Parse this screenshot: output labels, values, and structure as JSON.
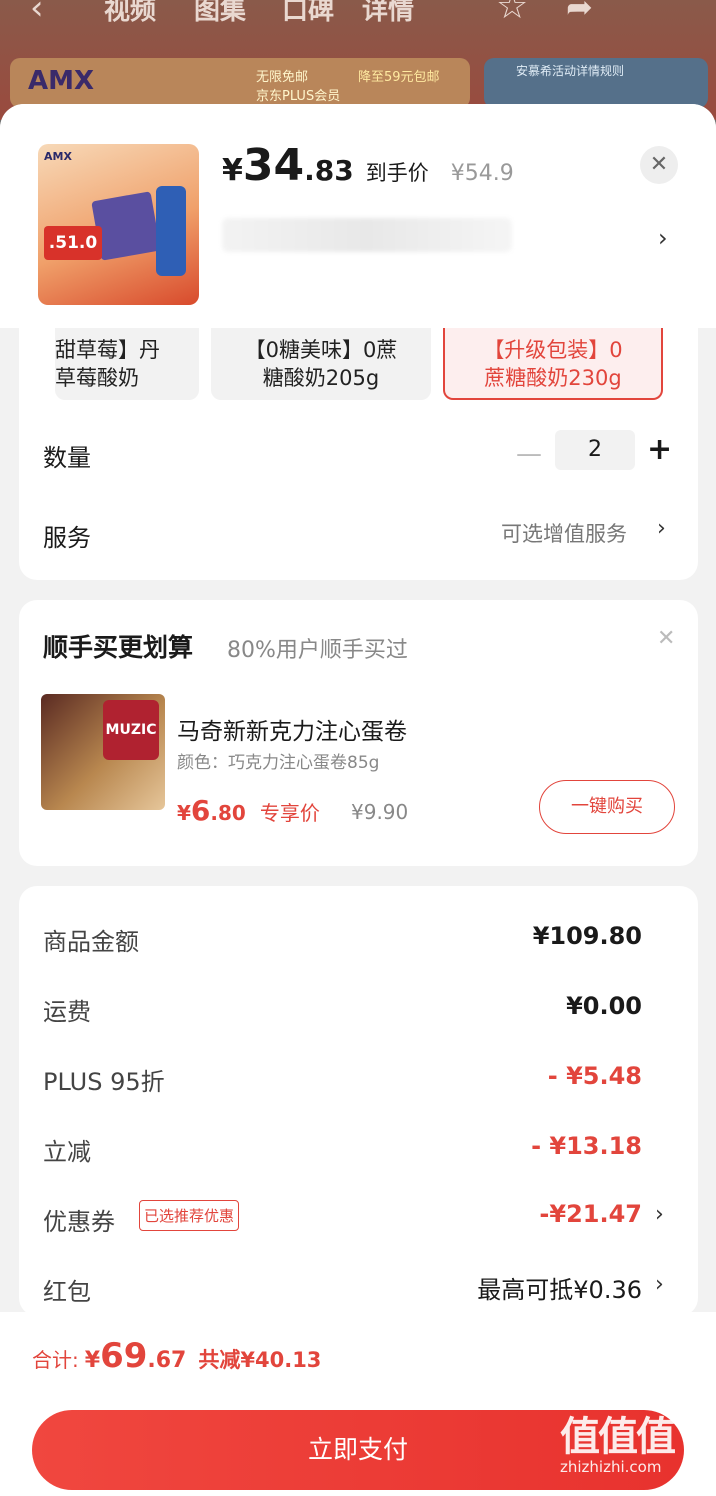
{
  "background": {
    "tabs": [
      "视频",
      "图集",
      "口碑",
      "详情"
    ],
    "banner_brand": "AMX",
    "banner_free_ship": "无限免邮",
    "banner_discount": "降至59元包邮",
    "banner_plus": "京东PLUS会员",
    "right_banner_title": "安慕希活动详情规则"
  },
  "product": {
    "thumb_brand": "AMX",
    "thumb_price": ".51.0",
    "price_symbol": "¥",
    "price_int": "34",
    "price_dec": ".83",
    "price_tag": "到手价",
    "original_price": "¥54.9"
  },
  "specs": [
    {
      "label": "甜草莓】丹\n草莓酸奶"
    },
    {
      "label": "【0糖美味】0蔗\n糖酸奶205g"
    },
    {
      "label": "【升级包装】0\n蔗糖酸奶230g",
      "selected": true
    }
  ],
  "quantity": {
    "label": "数量",
    "value": "2"
  },
  "service": {
    "label": "服务",
    "value": "可选增值服务"
  },
  "addon": {
    "title": "顺手买更划算",
    "subtitle": "80%用户顺手买过",
    "can_label": "MUZIC",
    "name": "马奇新新克力注心蛋卷",
    "color": "颜色：巧克力注心蛋卷85g",
    "price_symbol": "¥",
    "price_int": "6",
    "price_dec": ".80",
    "price_tag": "专享价",
    "original_price": "¥9.90",
    "buy_label": "一键购买"
  },
  "fees": [
    {
      "label": "商品金额",
      "value": "¥109.80"
    },
    {
      "label": "运费",
      "value": "¥0.00"
    },
    {
      "label": "PLUS 95折",
      "value": "- ¥5.48"
    },
    {
      "label": "立减",
      "value": "- ¥13.18"
    },
    {
      "label": "优惠券",
      "value": "-¥21.47",
      "badge": "已选推荐优惠"
    },
    {
      "label": "红包",
      "value": "最高可抵¥0.36"
    }
  ],
  "total": {
    "label": "合计:",
    "symbol": "¥",
    "int": "69",
    "dec": ".67",
    "reduced": "共减¥40.13"
  },
  "pay_button": "立即支付",
  "watermark": {
    "logo": "值值值",
    "url": "zhizhizhi.com"
  },
  "colors": {
    "accent": "#e2453c",
    "sheet_bg": "#f2f2f2"
  }
}
